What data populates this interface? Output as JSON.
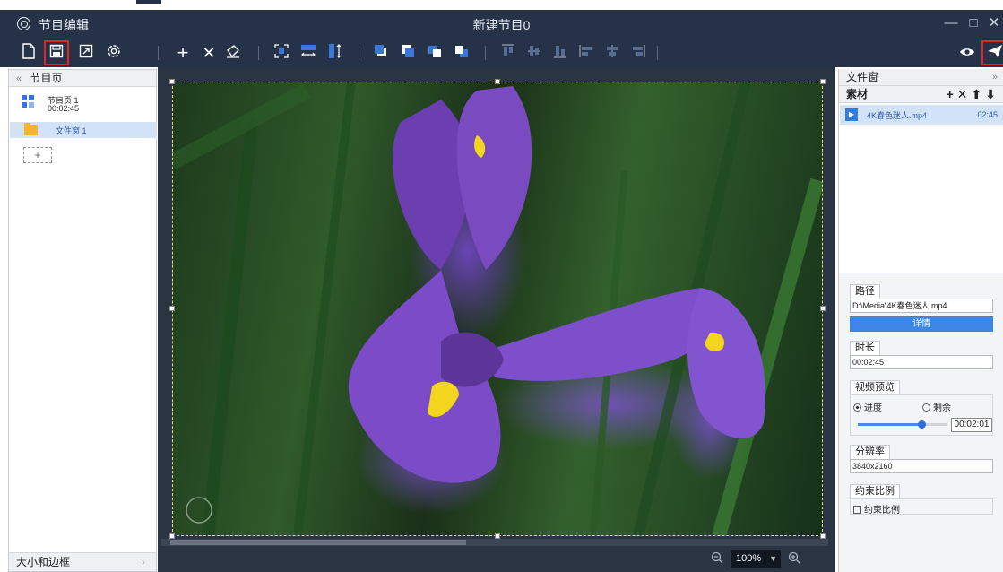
{
  "titlebar": {
    "app_title": "节目编辑",
    "document_title": "新建节目0"
  },
  "window_controls": {
    "minimize": "—",
    "maximize": "□",
    "close": "✕"
  },
  "left_panel": {
    "header": "节目页",
    "pages": [
      {
        "name": "节目页 1",
        "duration": "00:02:45"
      }
    ],
    "windows": [
      {
        "name": "文件窗 1"
      }
    ],
    "add_label": "+",
    "footer": "大小和边框"
  },
  "canvas": {
    "zoom": "100%"
  },
  "right_panel": {
    "header": "文件窗",
    "media_header": "素材",
    "media_ops": [
      "+",
      "✕",
      "⬆",
      "⬇"
    ],
    "media": [
      {
        "name": "4K春色迷人.mp4",
        "duration": "02:45"
      }
    ],
    "path": {
      "label": "路径",
      "value": "D:\\Media\\4K春色迷人.mp4",
      "details_button": "详情"
    },
    "duration": {
      "label": "时长",
      "value": "00:02:45"
    },
    "preview": {
      "label": "视频预览",
      "option_progress": "进度",
      "option_remaining": "剩余",
      "selected": "进度",
      "progress_fraction": 0.71,
      "time": "00:02:01"
    },
    "resolution": {
      "label": "分辨率",
      "value": "3840x2160"
    },
    "aspect": {
      "label": "约束比例",
      "checkbox_label": "约束比例",
      "checked": false
    }
  },
  "colors": {
    "chrome": "#263248",
    "accent": "#3a78d8",
    "selection": "#d2e2f7",
    "highlight_box": "#e02525"
  }
}
